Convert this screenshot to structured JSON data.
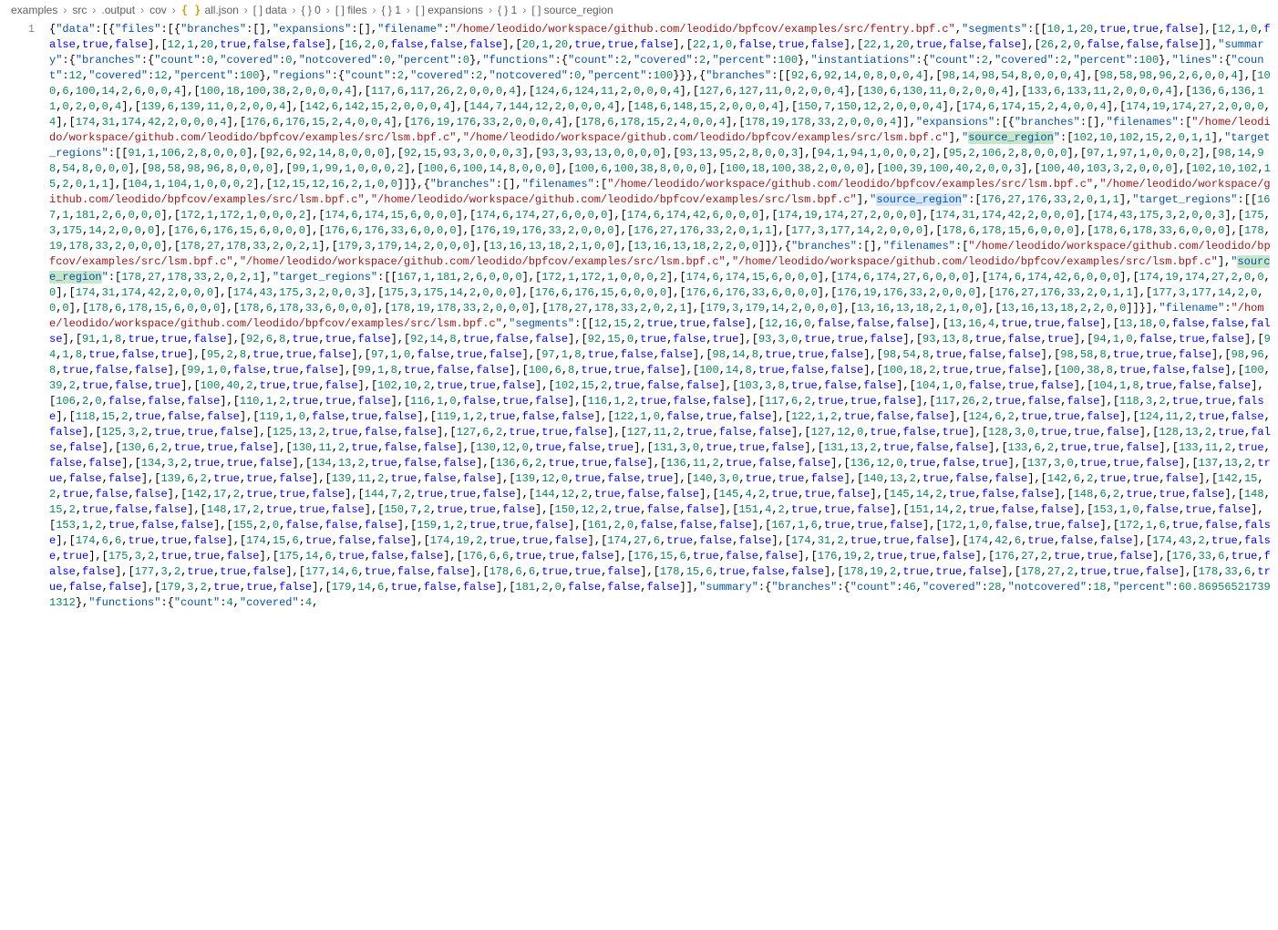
{
  "breadcrumb": {
    "parts": [
      "examples",
      "src",
      ".output",
      "cov",
      "all.json",
      "[ ] data",
      "{ } 0",
      "[ ] files",
      "{ } 1",
      "[ ] expansions",
      "{ } 1",
      "[ ] source_region"
    ],
    "file_icon": "{ }"
  },
  "line_number": "1",
  "highlighted_key": "source_region",
  "json_text": "{\"data\":[{\"files\":[{\"branches\":[],\"expansions\":[],\"filename\":\"/home/leodido/workspace/github.com/leodido/bpfcov/examples/src/fentry.bpf.c\",\"segments\":[[10,1,20,true,true,false],[12,1,0,false,true,false],[12,1,20,true,false,false],[16,2,0,false,false,false],[20,1,20,true,true,false],[22,1,0,false,true,false],[22,1,20,true,false,false],[26,2,0,false,false,false]],\"summary\":{\"branches\":{\"count\":0,\"covered\":0,\"notcovered\":0,\"percent\":0},\"functions\":{\"count\":2,\"covered\":2,\"percent\":100},\"instantiations\":{\"count\":2,\"covered\":2,\"percent\":100},\"lines\":{\"count\":12,\"covered\":12,\"percent\":100},\"regions\":{\"count\":2,\"covered\":2,\"notcovered\":0,\"percent\":100}}},{\"branches\":[[92,6,92,14,0,8,0,0,4],[98,14,98,54,8,0,0,0,4],[98,58,98,96,2,6,0,0,4],[100,6,100,14,2,6,0,0,4],[100,18,100,38,2,0,0,0,4],[117,6,117,26,2,0,0,0,4],[124,6,124,11,2,0,0,0,4],[127,6,127,11,0,2,0,0,4],[130,6,130,11,0,2,0,0,4],[133,6,133,11,2,0,0,0,4],[136,6,136,11,0,2,0,0,4],[139,6,139,11,0,2,0,0,4],[142,6,142,15,2,0,0,0,4],[144,7,144,12,2,0,0,0,4],[148,6,148,15,2,0,0,0,4],[150,7,150,12,2,0,0,0,4],[174,6,174,15,2,4,0,0,4],[174,19,174,27,2,0,0,0,4],[174,31,174,42,2,0,0,0,4],[176,6,176,15,2,4,0,0,4],[176,19,176,33,2,0,0,0,4],[178,6,178,15,2,4,0,0,4],[178,19,178,33,2,0,0,0,4]],\"expansions\":[{\"branches\":[],\"filenames\":[\"/home/leodido/workspace/github.com/leodido/bpfcov/examples/src/lsm.bpf.c\",\"/home/leodido/workspace/github.com/leodido/bpfcov/examples/src/lsm.bpf.c\"],\"source_region\":[102,10,102,15,2,0,1,1],\"target_regions\":[[91,1,106,2,8,0,0,0],[92,6,92,14,8,0,0,0],[92,15,93,3,0,0,0,3],[93,3,93,13,0,0,0,0],[93,13,95,2,8,0,0,3],[94,1,94,1,0,0,0,2],[95,2,106,2,8,0,0,0],[97,1,97,1,0,0,0,2],[98,14,98,54,8,0,0,0],[98,58,98,96,8,0,0,0],[99,1,99,1,0,0,0,2],[100,6,100,14,8,0,0,0],[100,6,100,38,8,0,0,0],[100,18,100,38,2,0,0,0],[100,39,100,40,2,0,0,3],[100,40,103,3,2,0,0,0],[102,10,102,15,2,0,1,1],[104,1,104,1,0,0,0,2],[12,15,12,16,2,1,0,0]]},{\"branches\":[],\"filenames\":[\"/home/leodido/workspace/github.com/leodido/bpfcov/examples/src/lsm.bpf.c\",\"/home/leodido/workspace/github.com/leodido/bpfcov/examples/src/lsm.bpf.c\",\"/home/leodido/workspace/github.com/leodido/bpfcov/examples/src/lsm.bpf.c\"],\"source_region\":[176,27,176,33,2,0,1,1],\"target_regions\":[[167,1,181,2,6,0,0,0],[172,1,172,1,0,0,0,2],[174,6,174,15,6,0,0,0],[174,6,174,27,6,0,0,0],[174,6,174,42,6,0,0,0],[174,19,174,27,2,0,0,0],[174,31,174,42,2,0,0,0],[174,43,175,3,2,0,0,3],[175,3,175,14,2,0,0,0],[176,6,176,15,6,0,0,0],[176,6,176,33,6,0,0,0],[176,19,176,33,2,0,0,0],[176,27,176,33,2,0,1,1],[177,3,177,14,2,0,0,0],[178,6,178,15,6,0,0,0],[178,6,178,33,6,0,0,0],[178,19,178,33,2,0,0,0],[178,27,178,33,2,0,2,1],[179,3,179,14,2,0,0,0],[13,16,13,18,2,1,0,0],[13,16,13,18,2,2,0,0]]},{\"branches\":[],\"filenames\":[\"/home/leodido/workspace/github.com/leodido/bpfcov/examples/src/lsm.bpf.c\",\"/home/leodido/workspace/github.com/leodido/bpfcov/examples/src/lsm.bpf.c\",\"/home/leodido/workspace/github.com/leodido/bpfcov/examples/src/lsm.bpf.c\"],\"source_region\":[178,27,178,33,2,0,2,1],\"target_regions\":[[167,1,181,2,6,0,0,0],[172,1,172,1,0,0,0,2],[174,6,174,15,6,0,0,0],[174,6,174,27,6,0,0,0],[174,6,174,42,6,0,0,0],[174,19,174,27,2,0,0,0],[174,31,174,42,2,0,0,0],[174,43,175,3,2,0,0,3],[175,3,175,14,2,0,0,0],[176,6,176,15,6,0,0,0],[176,6,176,33,6,0,0,0],[176,19,176,33,2,0,0,0],[176,27,176,33,2,0,1,1],[177,3,177,14,2,0,0,0],[178,6,178,15,6,0,0,0],[178,6,178,33,6,0,0,0],[178,19,178,33,2,0,0,0],[178,27,178,33,2,0,2,1],[179,3,179,14,2,0,0,0],[13,16,13,18,2,1,0,0],[13,16,13,18,2,2,0,0]]}],\"filename\":\"/home/leodido/workspace/github.com/leodido/bpfcov/examples/src/lsm.bpf.c\",\"segments\":[[12,15,2,true,true,false],[12,16,0,false,false,false],[13,16,4,true,true,false],[13,18,0,false,false,false],[91,1,8,true,true,false],[92,6,8,true,true,false],[92,14,8,true,false,false],[92,15,0,true,false,true],[93,3,0,true,true,false],[93,13,8,true,false,true],[94,1,0,false,true,false],[94,1,8,true,false,true],[95,2,8,true,true,false],[97,1,0,false,true,false],[97,1,8,true,false,false],[98,14,8,true,true,false],[98,54,8,true,false,false],[98,58,8,true,true,false],[98,96,8,true,false,false],[99,1,0,false,true,false],[99,1,8,true,false,false],[100,6,8,true,true,false],[100,14,8,true,false,false],[100,18,2,true,true,false],[100,38,8,true,false,false],[100,39,2,true,false,true],[100,40,2,true,true,false],[102,10,2,true,true,false],[102,15,2,true,false,false],[103,3,8,true,false,false],[104,1,0,false,true,false],[104,1,8,true,false,false],[106,2,0,false,false,false],[110,1,2,true,true,false],[116,1,0,false,true,false],[116,1,2,true,false,false],[117,6,2,true,true,false],[117,26,2,true,false,false],[118,3,2,true,true,false],[118,15,2,true,false,false],[119,1,0,false,true,false],[119,1,2,true,false,false],[122,1,0,false,true,false],[122,1,2,true,false,false],[124,6,2,true,true,false],[124,11,2,true,false,false],[125,3,2,true,true,false],[125,13,2,true,false,false],[127,6,2,true,true,false],[127,11,2,true,false,false],[127,12,0,true,false,true],[128,3,0,true,true,false],[128,13,2,true,false,false],[130,6,2,true,true,false],[130,11,2,true,false,false],[130,12,0,true,false,true],[131,3,0,true,true,false],[131,13,2,true,false,false],[133,6,2,true,true,false],[133,11,2,true,false,false],[134,3,2,true,true,false],[134,13,2,true,false,false],[136,6,2,true,true,false],[136,11,2,true,false,false],[136,12,0,true,false,true],[137,3,0,true,true,false],[137,13,2,true,false,false],[139,6,2,true,true,false],[139,11,2,true,false,false],[139,12,0,true,false,true],[140,3,0,true,true,false],[140,13,2,true,false,false],[142,6,2,true,true,false],[142,15,2,true,false,false],[142,17,2,true,true,false],[144,7,2,true,true,false],[144,12,2,true,false,false],[145,4,2,true,true,false],[145,14,2,true,false,false],[148,6,2,true,true,false],[148,15,2,true,false,false],[148,17,2,true,true,false],[150,7,2,true,true,false],[150,12,2,true,false,false],[151,4,2,true,true,false],[151,14,2,true,false,false],[153,1,0,false,true,false],[153,1,2,true,false,false],[155,2,0,false,false,false],[159,1,2,true,true,false],[161,2,0,false,false,false],[167,1,6,true,true,false],[172,1,0,false,true,false],[172,1,6,true,false,false],[174,6,6,true,true,false],[174,15,6,true,false,false],[174,19,2,true,true,false],[174,27,6,true,false,false],[174,31,2,true,true,false],[174,42,6,true,false,false],[174,43,2,true,false,true],[175,3,2,true,true,false],[175,14,6,true,false,false],[176,6,6,true,true,false],[176,15,6,true,false,false],[176,19,2,true,true,false],[176,27,2,true,true,false],[176,33,6,true,false,false],[177,3,2,true,true,false],[177,14,6,true,false,false],[178,6,6,true,true,false],[178,15,6,true,false,false],[178,19,2,true,true,false],[178,27,2,true,true,false],[178,33,6,true,false,false],[179,3,2,true,true,false],[179,14,6,true,false,false],[181,2,0,false,false,false]],\"summary\":{\"branches\":{\"count\":46,\"covered\":28,\"notcovered\":18,\"percent\":60.869565217391312},\"functions\":{\"count\":4,\"covered\":4,"
}
